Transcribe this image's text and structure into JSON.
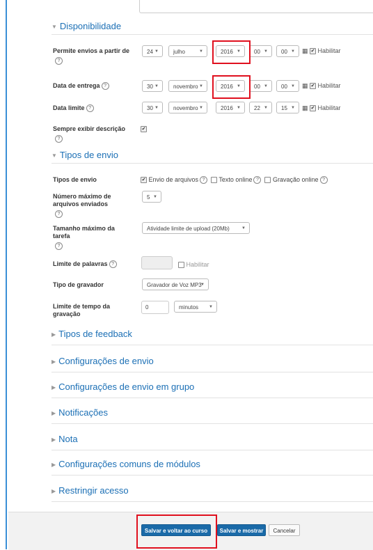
{
  "sections": {
    "disponibilidade": "Disponibilidade",
    "tipos_envio": "Tipos de envio",
    "collapsed": [
      "Tipos de feedback",
      "Configurações de envio",
      "Configurações de envio em grupo",
      "Notificações",
      "Nota",
      "Configurações comuns de módulos",
      "Restringir acesso"
    ]
  },
  "availability": {
    "allow_from": {
      "label": "Permite envios a partir de",
      "day": "24",
      "month": "julho",
      "year": "2016",
      "hour": "00",
      "minute": "00",
      "enable": "Habilitar"
    },
    "due": {
      "label": "Data de entrega",
      "day": "30",
      "month": "novembro",
      "year": "2016",
      "hour": "00",
      "minute": "00",
      "enable": "Habilitar"
    },
    "cutoff": {
      "label": "Data limite",
      "day": "30",
      "month": "novembro",
      "year": "2016",
      "hour": "22",
      "minute": "15",
      "enable": "Habilitar"
    },
    "always_show": {
      "label": "Sempre exibir descrição"
    }
  },
  "submission": {
    "types": {
      "label": "Tipos de envio",
      "file": "Envio de arquivos",
      "online_text": "Texto online",
      "recording": "Gravação online"
    },
    "max_files": {
      "label": "Número máximo de arquivos enviados",
      "value": "5"
    },
    "max_size": {
      "label": "Tamanho máximo da tarefa",
      "value": "Atividade limite de upload (20Mb)"
    },
    "word_limit": {
      "label": "Limite de palavras",
      "enable": "Habilitar"
    },
    "recorder": {
      "label": "Tipo de gravador",
      "value": "Gravador de Voz MP3"
    },
    "time_limit": {
      "label": "Limite de tempo da gravação",
      "value": "0",
      "unit": "minutos"
    }
  },
  "footer": {
    "save_return": "Salvar e voltar ao curso",
    "save_show": "Salvar e mostrar",
    "cancel": "Cancelar"
  },
  "colors": {
    "accent": "#1b6fb5",
    "highlight": "#e0101e",
    "primary_button": "#1a6aa8"
  }
}
